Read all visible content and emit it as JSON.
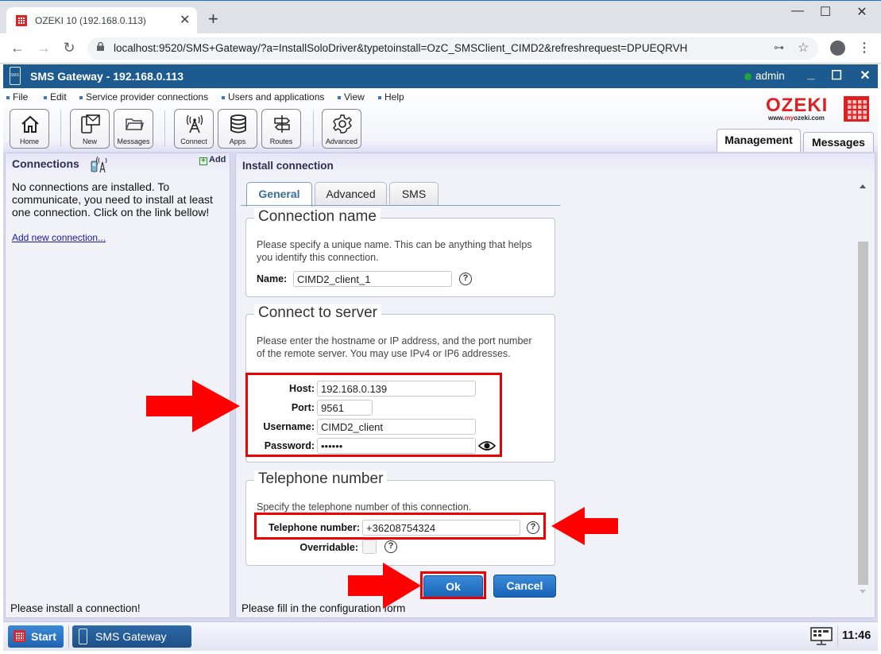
{
  "browser": {
    "tab_title": "OZEKI 10 (192.168.0.113)",
    "url": "localhost:9520/SMS+Gateway/?a=InstallSoloDriver&typetoinstall=OzC_SMSClient_CIMD2&refreshrequest=DPUEQRVH"
  },
  "app": {
    "title": "SMS Gateway - 192.168.0.113",
    "icon_text": "SMS",
    "user": "admin",
    "user_status_color": "#1ea43a",
    "accent_color": "#1c5a8f"
  },
  "menu": [
    "File",
    "Edit",
    "Service provider connections",
    "Users and applications",
    "View",
    "Help"
  ],
  "toolbar": [
    {
      "label": "Home",
      "icon": "home-icon"
    },
    {
      "label": "New",
      "icon": "new-message-icon"
    },
    {
      "label": "Messages",
      "icon": "folder-icon"
    },
    {
      "label": "Connect",
      "icon": "antenna-icon"
    },
    {
      "label": "Apps",
      "icon": "database-icon"
    },
    {
      "label": "Routes",
      "icon": "signpost-icon"
    },
    {
      "label": "Advanced",
      "icon": "gear-icon"
    }
  ],
  "logo": {
    "word": "OZEKI",
    "url_prefix": "www.",
    "url_my": "my",
    "url_suffix": "ozeki.com"
  },
  "main_tabs": [
    "Management",
    "Messages"
  ],
  "left_panel": {
    "title": "Connections",
    "add_label": "Add",
    "message": "No connections are installed. To communicate, you need to install at least one connection. Click on the link bellow!",
    "link": "Add new connection...",
    "status": "Please install a connection!"
  },
  "right_panel": {
    "title": "Install connection",
    "tabs": [
      "General",
      "Advanced",
      "SMS"
    ],
    "active_tab": "General",
    "status": "Please fill in the configuration form",
    "sections": {
      "connection_name": {
        "legend": "Connection name",
        "description": "Please specify a unique name. This can be anything that helps you identify this connection.",
        "name_label": "Name:",
        "name_value": "CIMD2_client_1"
      },
      "connect_to_server": {
        "legend": "Connect to server",
        "description": "Please enter the hostname or IP address, and the port number of the remote server. You may use IPv4 or IP6 addresses.",
        "host_label": "Host:",
        "host_value": "192.168.0.139",
        "port_label": "Port:",
        "port_value": "9561",
        "username_label": "Username:",
        "username_value": "CIMD2_client",
        "password_label": "Password:",
        "password_value": "••••••"
      },
      "telephone_number": {
        "legend": "Telephone number",
        "description": "Specify the telephone number of this connection.",
        "tel_label": "Telephone number:",
        "tel_value": "+36208754324",
        "overridable_label": "Overridable:",
        "overridable_checked": false
      }
    },
    "help_glyph": "?",
    "ok_label": "Ok",
    "cancel_label": "Cancel"
  },
  "taskbar": {
    "start_label": "Start",
    "app_label": "SMS Gateway",
    "clock": "11:46"
  },
  "annotation_color": "#ee0000"
}
